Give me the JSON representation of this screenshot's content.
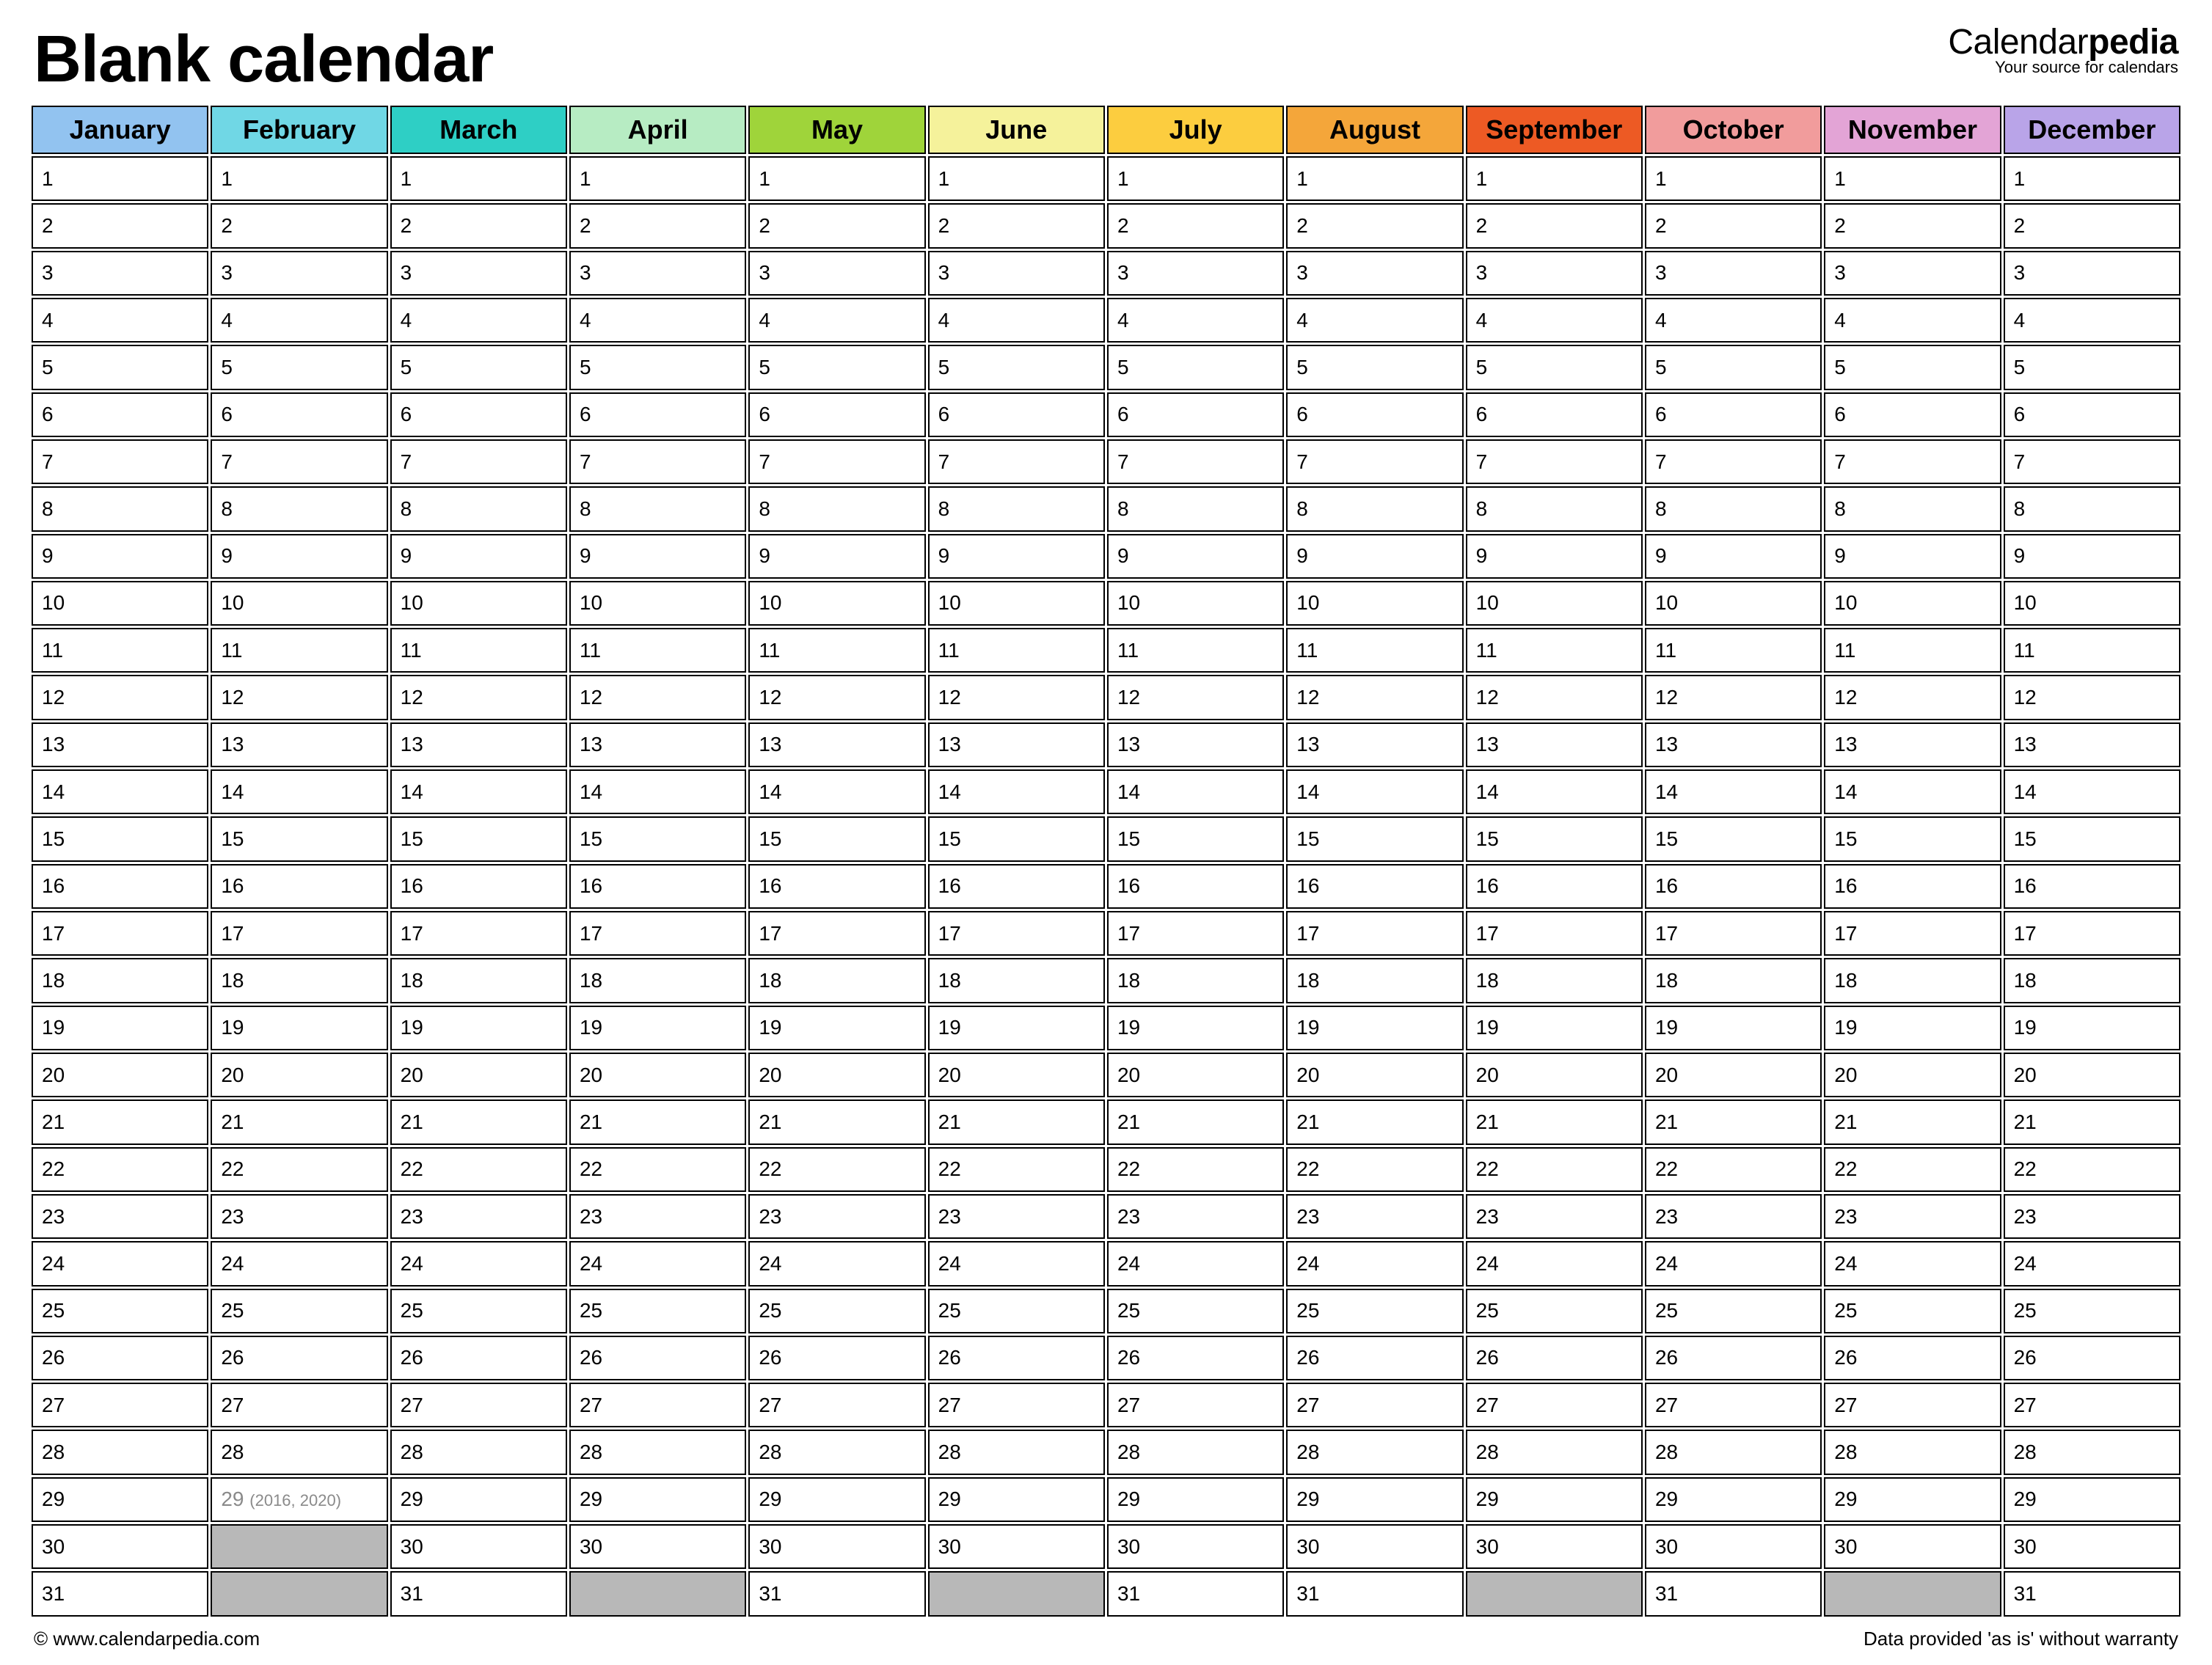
{
  "header": {
    "title": "Blank calendar",
    "brand_prefix": "Calendar",
    "brand_suffix": "pedia",
    "brand_sub": "Your source for calendars"
  },
  "months": [
    {
      "name": "January",
      "color": "#92c3f0",
      "days": 31
    },
    {
      "name": "February",
      "color": "#70d7e5",
      "days": 29,
      "leap_day": 29,
      "leap_note": "(2016, 2020)"
    },
    {
      "name": "March",
      "color": "#2ecfc5",
      "days": 31
    },
    {
      "name": "April",
      "color": "#b7ecc3",
      "days": 30
    },
    {
      "name": "May",
      "color": "#9fd43a",
      "days": 31
    },
    {
      "name": "June",
      "color": "#f5f29b",
      "days": 30
    },
    {
      "name": "July",
      "color": "#fccd3f",
      "days": 31
    },
    {
      "name": "August",
      "color": "#f4a63a",
      "days": 31
    },
    {
      "name": "September",
      "color": "#ed5a24",
      "days": 30
    },
    {
      "name": "October",
      "color": "#f19c9c",
      "days": 31
    },
    {
      "name": "November",
      "color": "#e3a4d6",
      "days": 30
    },
    {
      "name": "December",
      "color": "#b9a4e8",
      "days": 31
    }
  ],
  "max_rows": 31,
  "footer": {
    "left": "© www.calendarpedia.com",
    "right": "Data provided 'as is' without warranty"
  }
}
